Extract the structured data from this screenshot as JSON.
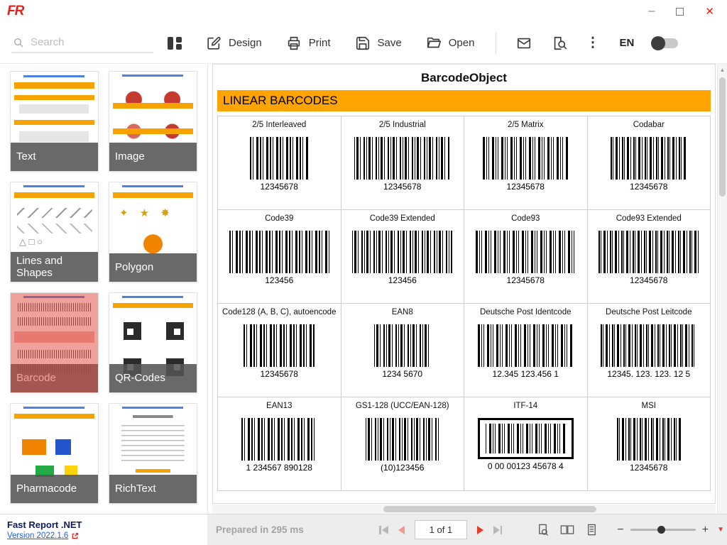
{
  "window": {
    "logo": "FR",
    "controls": {
      "minimize": "–",
      "close": "✕"
    }
  },
  "toolbar": {
    "search_placeholder": "Search",
    "design_label": "Design",
    "print_label": "Print",
    "save_label": "Save",
    "open_label": "Open",
    "language": "EN"
  },
  "icons": {
    "kebab": "⋮",
    "scroll_up": "▲",
    "scroll_down": "▼",
    "zoom_out": "−",
    "zoom_in": "+"
  },
  "sidebar": {
    "items": [
      {
        "id": "text",
        "label": "Text",
        "selected": false
      },
      {
        "id": "image",
        "label": "Image",
        "selected": false
      },
      {
        "id": "lines",
        "label": "Lines and Shapes",
        "selected": false
      },
      {
        "id": "polygon",
        "label": "Polygon",
        "selected": false
      },
      {
        "id": "barcode",
        "label": "Barcode",
        "selected": true
      },
      {
        "id": "qrcodes",
        "label": "QR-Codes",
        "selected": false
      },
      {
        "id": "pharmacode",
        "label": "Pharmacode",
        "selected": false
      },
      {
        "id": "richtext",
        "label": "RichText",
        "selected": false
      }
    ]
  },
  "report": {
    "title": "BarcodeObject",
    "section_header": "LINEAR BARCODES",
    "barcodes": [
      {
        "name": "2/5 Interleaved",
        "value": "12345678",
        "framed": false
      },
      {
        "name": "2/5 Industrial",
        "value": "12345678",
        "framed": false
      },
      {
        "name": "2/5 Matrix",
        "value": "12345678",
        "framed": false
      },
      {
        "name": "Codabar",
        "value": "12345678",
        "framed": false
      },
      {
        "name": "Code39",
        "value": "123456",
        "framed": false
      },
      {
        "name": "Code39 Extended",
        "value": "123456",
        "framed": false
      },
      {
        "name": "Code93",
        "value": "12345678",
        "framed": false
      },
      {
        "name": "Code93 Extended",
        "value": "12345678",
        "framed": false
      },
      {
        "name": "Code128 (A, B, C), autoencode",
        "value": "12345678",
        "framed": false
      },
      {
        "name": "EAN8",
        "value": "1234 5670",
        "framed": false
      },
      {
        "name": "Deutsche Post Identcode",
        "value": "12.345 123.456 1",
        "framed": false
      },
      {
        "name": "Deutsche Post Leitcode",
        "value": "12345. 123. 123. 12 5",
        "framed": false
      },
      {
        "name": "EAN13",
        "value": "1 234567 890128",
        "framed": false
      },
      {
        "name": "GS1-128 (UCC/EAN-128)",
        "value": "(10)123456",
        "framed": false
      },
      {
        "name": "ITF-14",
        "value": "0 00 00123 45678 4",
        "framed": true
      },
      {
        "name": "MSI",
        "value": "12345678",
        "framed": false
      }
    ]
  },
  "statusbar": {
    "app_name": "Fast Report .NET",
    "version_link": "Version 2022.1.6",
    "prepared": "Prepared in 295 ms",
    "page_indicator": "1 of 1"
  }
}
